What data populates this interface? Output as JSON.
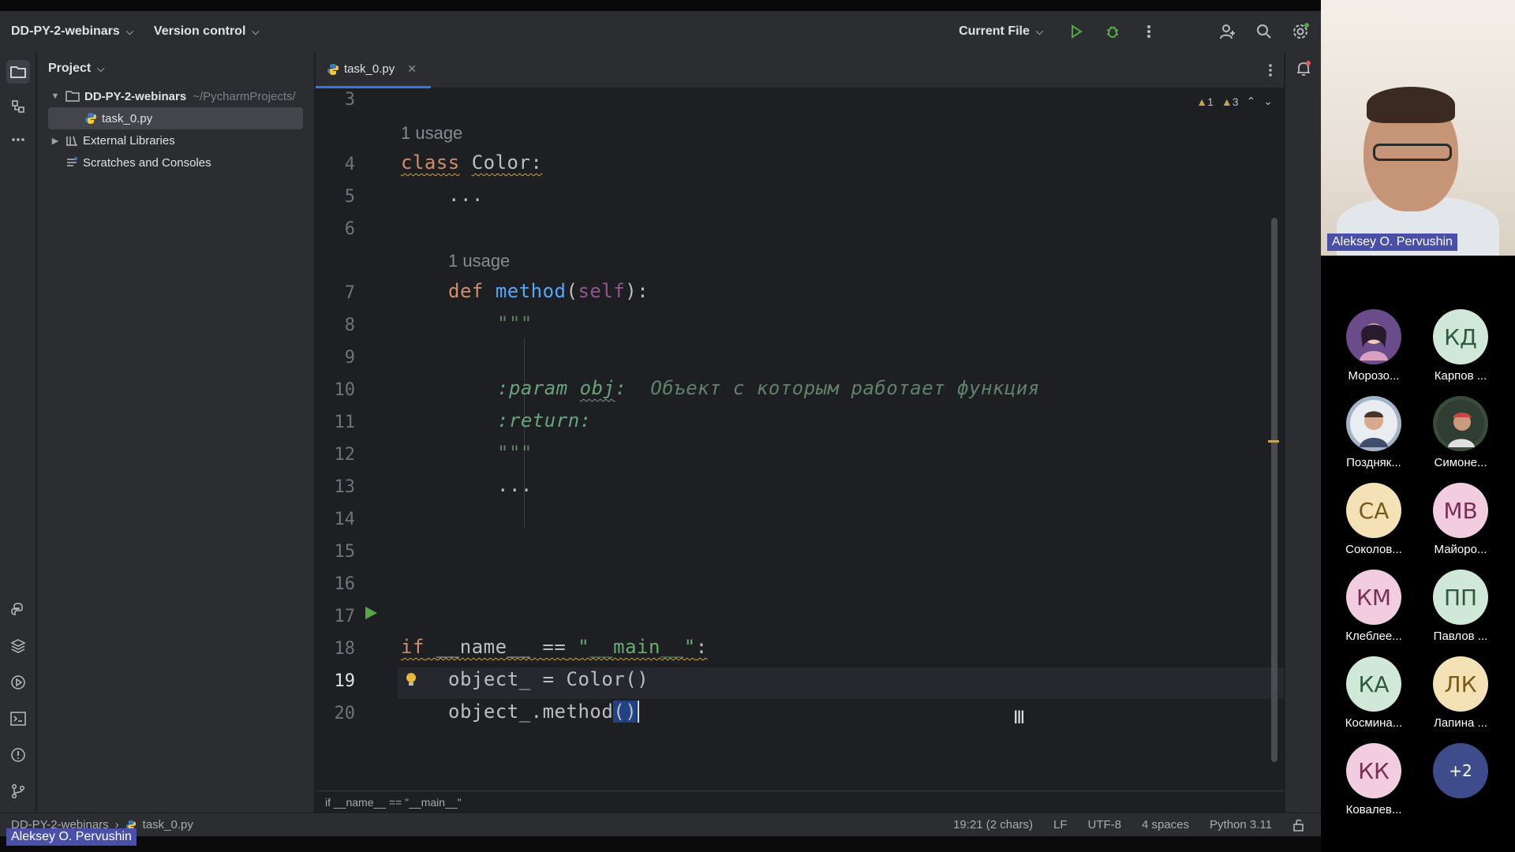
{
  "toolbar": {
    "project_name": "DD-PY-2-webinars",
    "vcs_label": "Version control",
    "run_config": "Current File"
  },
  "project_panel": {
    "title": "Project",
    "root_name": "DD-PY-2-webinars",
    "root_path": "~/PycharmProjects/",
    "file": "task_0.py",
    "external": "External Libraries",
    "scratches": "Scratches and Consoles"
  },
  "editor": {
    "tab_label": "task_0.py",
    "warnings_a": "1",
    "warnings_b": "3",
    "usage_hint": "1 usage",
    "line_numbers": [
      "3",
      "4",
      "5",
      "6",
      "7",
      "8",
      "9",
      "10",
      "11",
      "12",
      "13",
      "14",
      "15",
      "16",
      "17",
      "18",
      "19",
      "20"
    ],
    "code": {
      "class_kw": "class",
      "class_name": "Color:",
      "ellipsis": "...",
      "def_kw": "def",
      "method_name": "method",
      "self": "self",
      "paren_open": "(",
      "paren_close": "):",
      "triple": "\"\"\"",
      "param_tag": ":param",
      "param_name": "obj",
      "param_colon": ":",
      "param_desc": "Объект с которым работает функция",
      "return_tag": ":return:",
      "if_kw": "if",
      "dunder_name": "__name__",
      "eq": "==",
      "main_str": "\"__main__\"",
      "colon": ":",
      "line18": "object_ = Color()",
      "line19_prefix": "object_.method",
      "line19_sel": "()"
    },
    "breadcrumb": "if __name__ == \"__main__\""
  },
  "status": {
    "project": "DD-PY-2-webinars",
    "file": "task_0.py",
    "position": "19:21 (2 chars)",
    "line_sep": "LF",
    "encoding": "UTF-8",
    "indent": "4 spaces",
    "interpreter": "Python 3.11"
  },
  "meeting": {
    "presenter": "Aleksey O. Pervushin",
    "participants": [
      {
        "initials": "",
        "name": "Морозо...",
        "color": "#6b4c8a"
      },
      {
        "initials": "КД",
        "name": "Карпов ...",
        "color": "#cfe8d8"
      },
      {
        "initials": "",
        "name": "Поздняк...",
        "color": "#a3b4c8"
      },
      {
        "initials": "",
        "name": "Симоне...",
        "color": "#3a4b3a"
      },
      {
        "initials": "СА",
        "name": "Соколов...",
        "color": "#f5e1b6"
      },
      {
        "initials": "МВ",
        "name": "Майоро...",
        "color": "#f2cde0"
      },
      {
        "initials": "КМ",
        "name": "Клеблее...",
        "color": "#f2cde0"
      },
      {
        "initials": "ПП",
        "name": "Павлов ...",
        "color": "#cfe8d8"
      },
      {
        "initials": "КА",
        "name": "Космина...",
        "color": "#cfe8d8"
      },
      {
        "initials": "ЛК",
        "name": "Лапина ...",
        "color": "#f5e1b6"
      },
      {
        "initials": "КК",
        "name": "Ковалев...",
        "color": "#f2cde0"
      },
      {
        "initials": "+2",
        "name": "",
        "color": "#3e4c8c"
      }
    ]
  }
}
